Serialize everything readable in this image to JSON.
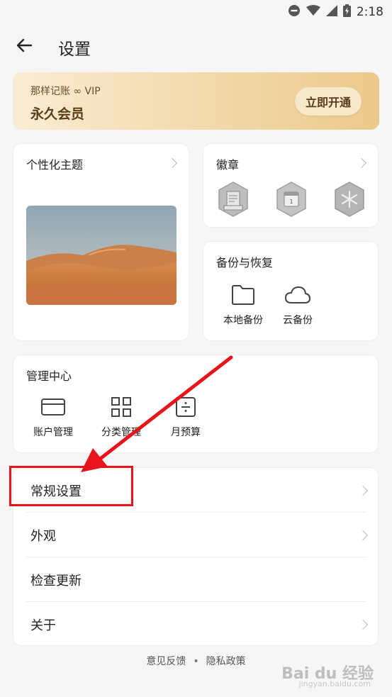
{
  "status_bar": {
    "time": "2:18",
    "icons": [
      "dnd-icon",
      "wifi-icon",
      "signal-icon",
      "battery-icon"
    ]
  },
  "header": {
    "title": "设置",
    "back_icon": "arrow-left-icon"
  },
  "vip_banner": {
    "subtitle": "那样记账 ∞ VIP",
    "title": "永久会员",
    "button_label": "立即开通"
  },
  "theme_card": {
    "title": "个性化主题"
  },
  "badge_card": {
    "title": "徽章",
    "badges": [
      "notebook-badge-icon",
      "calendar-badge-icon",
      "snowflake-badge-icon"
    ]
  },
  "backup_card": {
    "title": "备份与恢复",
    "items": [
      {
        "label": "本地备份",
        "icon": "folder-icon"
      },
      {
        "label": "云备份",
        "icon": "cloud-icon"
      }
    ]
  },
  "manage_card": {
    "title": "管理中心",
    "items": [
      {
        "label": "账户管理",
        "icon": "card-icon"
      },
      {
        "label": "分类管理",
        "icon": "grid-icon"
      },
      {
        "label": "月预算",
        "icon": "budget-icon"
      }
    ]
  },
  "settings_list": {
    "items": [
      {
        "label": "常规设置",
        "has_chevron": true
      },
      {
        "label": "外观",
        "has_chevron": true
      },
      {
        "label": "检查更新",
        "has_chevron": false
      },
      {
        "label": "关于",
        "has_chevron": true
      }
    ]
  },
  "footer": {
    "feedback": "意见反馈",
    "separator": "•",
    "privacy": "隐私政策"
  },
  "watermark": {
    "text": "Bai du 经验",
    "sub": "jingyan.baidu.com"
  },
  "colors": {
    "annotation_red": "#e8141b",
    "vip_gold": "#f2d7a6",
    "vip_text": "#5a3d17"
  }
}
